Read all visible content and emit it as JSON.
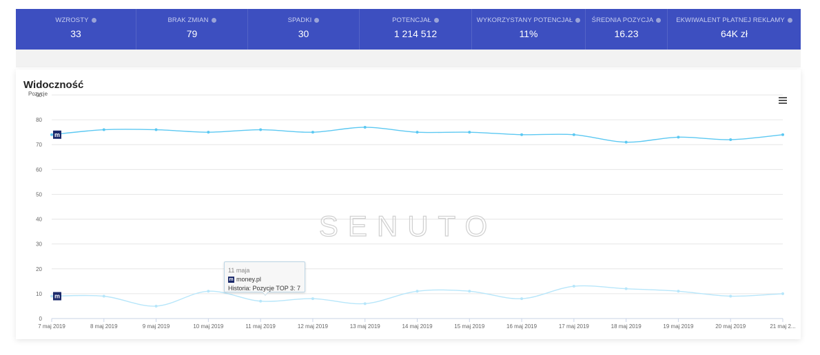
{
  "stats": [
    {
      "label": "WZROSTY",
      "value": "33"
    },
    {
      "label": "BRAK ZMIAN",
      "value": "79"
    },
    {
      "label": "SPADKI",
      "value": "30"
    },
    {
      "label": "POTENCJAŁ",
      "value": "1 214 512"
    },
    {
      "label": "WYKORZYSTANY POTENCJAŁ",
      "value": "11%"
    },
    {
      "label": "ŚREDNIA POZYCJA",
      "value": "16.23"
    },
    {
      "label": "EKWIWALENT PŁATNEJ REKLAMY",
      "value": "64K zł"
    }
  ],
  "card": {
    "title": "Widoczność",
    "menu_icon": "hamburger-menu-icon"
  },
  "watermark": "SENUTO",
  "colors": {
    "header_bg": "#3d4fc0",
    "series_top": "#5bc8f2",
    "series_bottom": "#b7e6fa",
    "badge": "#1b2a6b"
  },
  "chart_data": {
    "type": "line",
    "ylabel": "Pozycje",
    "ylim": [
      0,
      90
    ],
    "yticks": [
      0,
      10,
      20,
      30,
      40,
      50,
      60,
      70,
      80,
      90
    ],
    "categories": [
      "7 maj 2019",
      "8 maj 2019",
      "9 maj 2019",
      "10 maj 2019",
      "11 maj 2019",
      "12 maj 2019",
      "13 maj 2019",
      "14 maj 2019",
      "15 maj 2019",
      "16 maj 2019",
      "17 maj 2019",
      "18 maj 2019",
      "19 maj 2019",
      "20 maj 2019",
      "21 maj 2..."
    ],
    "series": [
      {
        "badge": "m",
        "values": [
          74,
          76,
          76,
          75,
          76,
          75,
          77,
          75,
          75,
          74,
          74,
          71,
          73,
          72,
          74
        ]
      },
      {
        "badge": "m",
        "values": [
          9,
          9,
          5,
          11,
          7,
          8,
          6,
          11,
          11,
          8,
          13,
          12,
          11,
          9,
          10
        ]
      }
    ],
    "grid": true,
    "tooltip": {
      "date": "11 maja",
      "site": "money.pl",
      "text": "Historia: Pozycje TOP 3: 7"
    }
  }
}
